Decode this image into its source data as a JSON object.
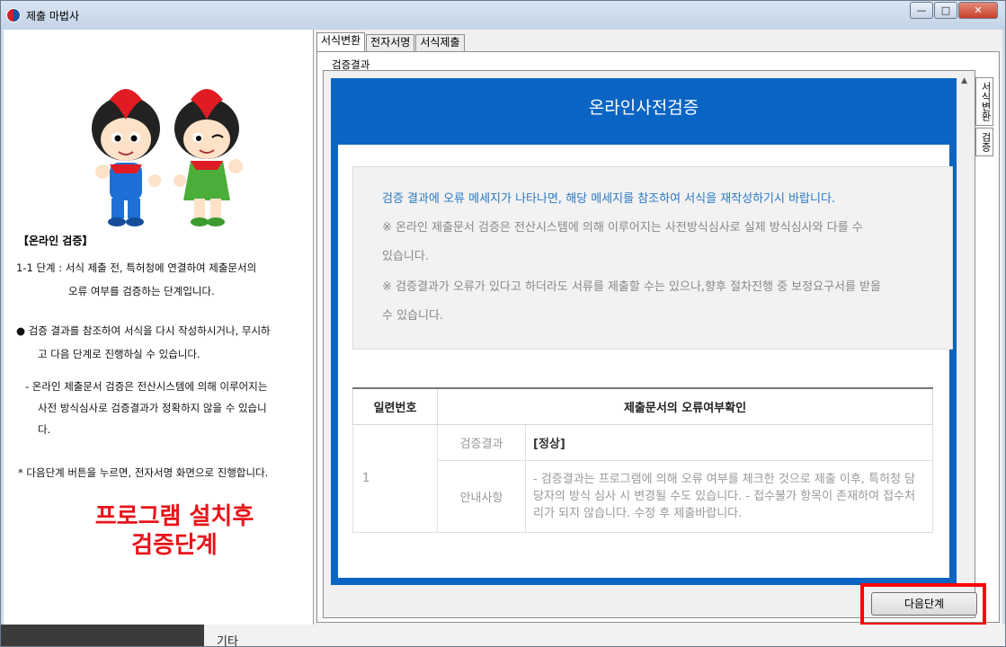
{
  "window": {
    "title": "제출 마법사",
    "buttons": {
      "minimize": "—",
      "maximize": "□",
      "close": "✕"
    }
  },
  "left": {
    "section_title": "【온라인 검증】",
    "lines": [
      "1-1 단계 : 서식 제출 전, 특허청에 연결하여 제출문서의",
      "오류 여부를 검증하는 단계입니다.",
      "● 검증 결과를 참조하여 서식을 다시 작성하시거나, 무시하",
      "고 다음 단계로 진행하실 수 있습니다.",
      "- 온라인 제출문서 검증은 전산시스템에 의해 이루어지는",
      "사전 방식심사로 검증결과가 정확하지 않을 수 있습니",
      "다.",
      "* 다음단계 버튼을 누르면, 전자서명 화면으로 진행합니다."
    ],
    "annotation_line1": "프로그램 설치후",
    "annotation_line2": "검증단계"
  },
  "tabs": [
    "서식변환",
    "전자서명",
    "서식제출"
  ],
  "inner_tab_label": "검증결과",
  "side_tabs": [
    "서식변환",
    "검증"
  ],
  "panel": {
    "title": "온라인사전검증",
    "notice_blue": "검증 결과에 오류 메세지가 나타나면, 해당 메세지를 참조하여 서식을 재작성하기시 바랍니다.",
    "notice_1a": "※ 온라인 제출문서 검증은 전산시스템에 의해 이루어지는 사전방식심사로 실제 방식심사와 다를 수",
    "notice_1b": "있습니다.",
    "notice_2a": "※ 검증결과가 오류가 있다고 하더라도 서류를 제출할 수는 있으나,향후 절차진행 중 보정요구서를 받을",
    "notice_2b": "수 있습니다."
  },
  "table": {
    "col1": "일련번호",
    "col2": "제출문서의 오류여부확인",
    "row_no": "1",
    "label_result": "검증결과",
    "value_result": "[정상]",
    "label_guide": "안내사항",
    "value_guide": "- 검증결과는 프로그램에 의해 오류 여부를 체크한 것으로 제출 이후, 특허청 담당자의 방식 심사 시 변경될 수도 있습니다. - 접수불가 항목이 존재하여 접수처리가 되지 않습니다. 수정 후 제출바랍니다."
  },
  "next_button": "다음단계",
  "bottom": {
    "label": "기타"
  },
  "colors": {
    "panel_blue": "#0a64c4",
    "annotation_red": "#e8141b",
    "highlight": "#ff0000"
  }
}
